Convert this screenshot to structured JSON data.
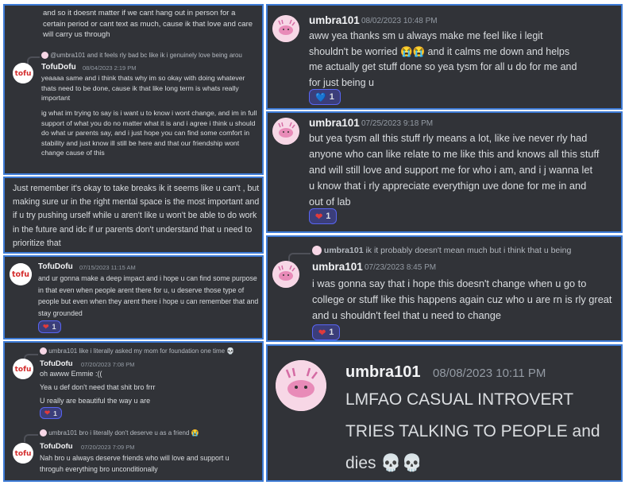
{
  "p1": {
    "top_text": "and so it doesnt matter if we cant hang out in person for a certain period or cant text as much, cause ik that love and care will carry us through",
    "reply_user": "@umbra101",
    "reply_text": "and it feels rly bad bc like ik i genuinely love being arou",
    "name": "TofuDofu",
    "time": "08/04/2023 2:19 PM",
    "line1": "yeaaaa same and i think thats why im so okay with doing whatever thats need to be done, cause ik that like long term is whats really important",
    "line2": "ig what im trying to say is i want u to know i wont change, and im in full support of what you do no matter what it is and i agree i think u should do what ur parents say, and i just hope you can find some comfort in stability and just know ill still be here and that our friendship wont change cause of this"
  },
  "p2": {
    "text": "Just remember it's okay to take breaks ik it seems like u can't , but making sure ur in the right mental space is the most important and if u try pushing urself while u aren't like u won't be able to do work in the future and idc if ur parents don't understand that u need to prioritize that"
  },
  "p3": {
    "name": "TofuDofu",
    "time": "07/15/2023 11:15 AM",
    "text": "and ur gonna make a deep impact and i hope u can find some purpose in that even when people arent there for u, u deserve those type of people but even when they arent there i hope u can remember that and stay grounded",
    "reaction_emoji": "❤",
    "reaction_count": "1"
  },
  "p4": {
    "reply1_text": "umbra101 like i literally asked my mom for foundation one time 💀",
    "msg1_name": "TofuDofu",
    "msg1_time": "07/20/2023 7:08 PM",
    "msg1_line1": "oh awww Emmie :((",
    "msg1_line2": "Yea u def don't need that shit bro frrr",
    "msg1_line3": "U really are beautiful the way u are",
    "reaction_emoji": "❤",
    "reaction_count": "1",
    "reply2_text": "umbra101 bro i literally don't deserve u as a friend 😭",
    "msg2_name": "TofuDofu",
    "msg2_time": "07/20/2023 7:09 PM",
    "msg2_text": "Nah bro u always deserve friends who will love and support u throguh everything bro unconditionally"
  },
  "r1": {
    "name": "umbra101",
    "time": "08/02/2023 10:48 PM",
    "text": "aww yea thanks sm u always make me feel like i legit shouldn't be worried 😭😭 and it calms me down and helps me actually get stuff done so yea tysm for all u do for me and for just being u",
    "reaction_emoji": "💙",
    "reaction_count": "1"
  },
  "r2": {
    "name": "umbra101",
    "time": "07/25/2023 9:18 PM",
    "text": "but yea tysm all this stuff rly means a lot, like ive never rly had anyone who can like relate to me like this and knows all this stuff and will still love and support me for who i am, and i j wanna let u know that i rly appreciate everythign uve done for me in and out of lab",
    "reaction_emoji": "❤",
    "reaction_count": "1"
  },
  "r3": {
    "reply_user": "umbra101",
    "reply_text": "ik it probably doesn't mean much but i think that u being",
    "name": "umbra101",
    "time": "07/23/2023 8:45 PM",
    "text": "i was gonna say that i hope this doesn't change when u go to college or stuff like this happens again cuz who u are rn is rly great and u shouldn't feel that u need to change",
    "reaction_emoji": "❤",
    "reaction_count": "1"
  },
  "r4": {
    "name": "umbra101",
    "time": "08/08/2023 10:11 PM",
    "text": "LMFAO CASUAL INTROVERT TRIES TALKING TO PEOPLE and dies 💀💀"
  },
  "avatars": {
    "tofu_label": "tofu"
  },
  "colors": {
    "panel_bg": "#313338",
    "border": "#3d7bd6",
    "reaction_bg": "#3b3e7a",
    "heart": "#e03b3b"
  }
}
